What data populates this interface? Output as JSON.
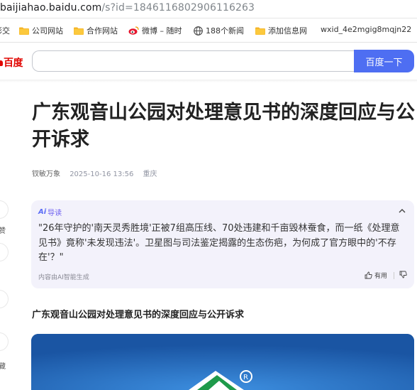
{
  "browser": {
    "url_domain": "baijiahao.baidu.com",
    "url_path": "/s?id=1846116802906116263"
  },
  "bookmarks": {
    "items": [
      {
        "label": "彩交",
        "icon": "partial-icon"
      },
      {
        "label": "公司网站",
        "icon": "folder-icon"
      },
      {
        "label": "合作网站",
        "icon": "folder-icon"
      },
      {
        "label": "微博 – 随时",
        "icon": "weibo-icon"
      },
      {
        "label": "188个新闻",
        "icon": "globe-icon"
      },
      {
        "label": "添加信息网",
        "icon": "folder-icon"
      },
      {
        "label": "wxid_4e2mgig8mqjn22",
        "icon": "none"
      }
    ]
  },
  "header": {
    "logo_text": "百度",
    "search_placeholder": "",
    "search_button_label": "百度一下"
  },
  "article": {
    "title": "广东观音山公园对处理意见书的深度回应与公开诉求",
    "author": "钗敏万象",
    "date": "2025-10-16 13:56",
    "location": "重庆",
    "subtitle": "广东观音山公园对处理意见书的深度回应与公开诉求"
  },
  "ai_guide": {
    "badge": "Ai",
    "label": "导读",
    "text": "\"26年守护的'南天灵秀胜境'正被7组高压线、70处违建和千亩毁林蚕食，而一纸《处理意见书》竟称'未发现违法'。卫星图与司法鉴定揭露的生态伤疤，为何成了官方眼中的'不存在'？\"",
    "footer": "内容由AI智能生成",
    "useful_label": "有用"
  },
  "side_panel": {
    "labels": [
      "赞",
      "藏"
    ]
  },
  "colors": {
    "brand_red": "#e10602",
    "search_blue": "#4e6ef2",
    "ai_purple": "#6b5cf0",
    "ai_bg": "#f3f2fb"
  }
}
